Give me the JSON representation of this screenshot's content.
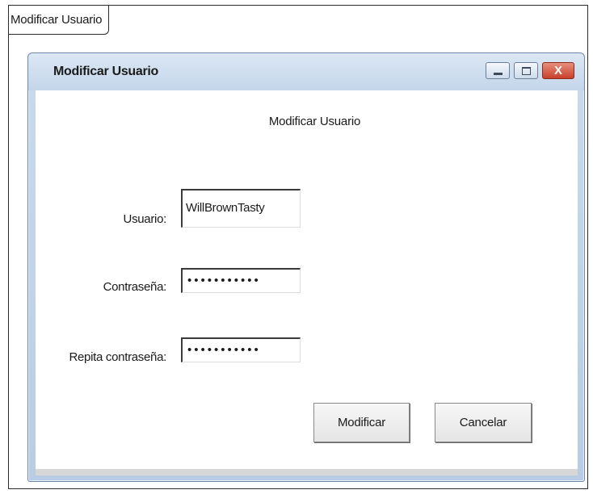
{
  "outer": {
    "tab_title": "Modificar Usuario"
  },
  "window": {
    "title": "Modificar Usuario",
    "controls": {
      "minimize_icon": "minimize-icon",
      "maximize_icon": "maximize-icon",
      "close_icon": "close-icon",
      "close_glyph": "X"
    }
  },
  "form": {
    "heading": "Modificar Usuario",
    "usuario_label": "Usuario:",
    "usuario_value": "WillBrownTasty",
    "contrasena_label": "Contraseña:",
    "contrasena_masked": "•••••••••••",
    "repita_label": "Repita contraseña:",
    "repita_masked": "•••••••••••",
    "modificar_label": "Modificar",
    "cancelar_label": "Cancelar"
  },
  "colors": {
    "title_bar": "#c4d6ea",
    "close_button": "#c8402a",
    "background": "#ffffff"
  }
}
